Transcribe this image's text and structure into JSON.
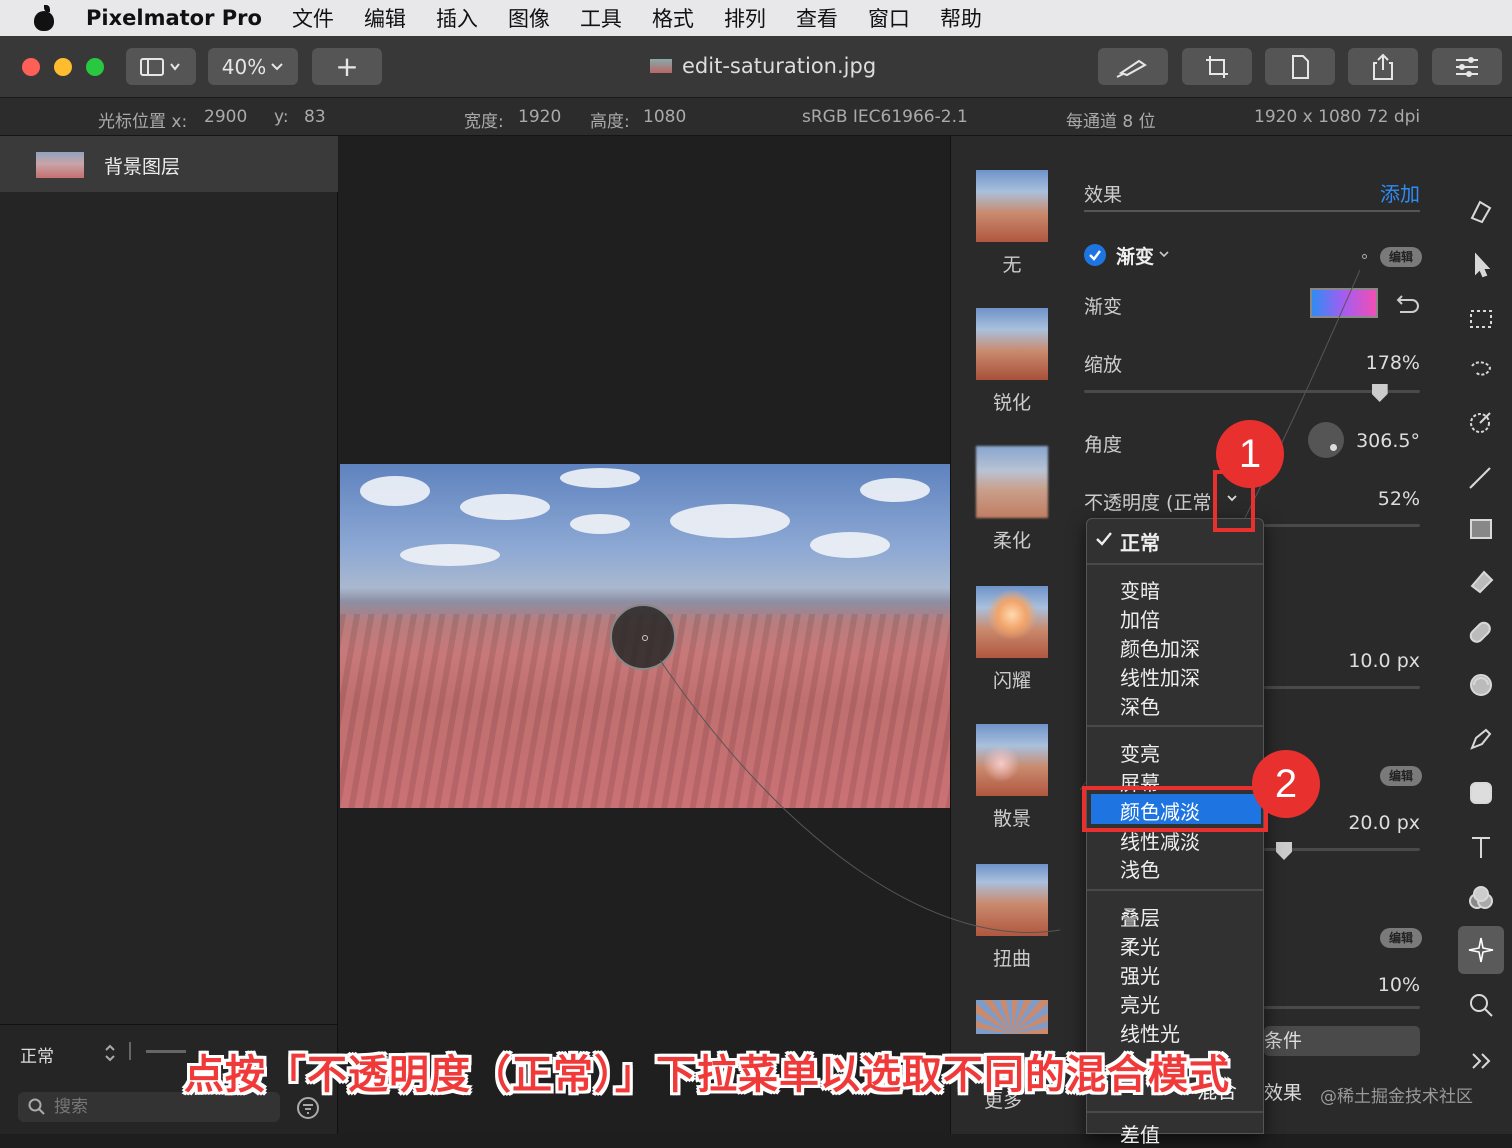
{
  "menubar": {
    "app": "Pixelmator Pro",
    "items": [
      "文件",
      "编辑",
      "插入",
      "图像",
      "工具",
      "格式",
      "排列",
      "查看",
      "窗口",
      "帮助"
    ]
  },
  "toolbar": {
    "zoom": "40%",
    "add": "+",
    "document_title": "edit-saturation.jpg"
  },
  "infobar": {
    "cursor_x_label": "光标位置 x:",
    "cursor_x": "2900",
    "cursor_y_label": "y:",
    "cursor_y": "83",
    "width_label": "宽度:",
    "width": "1920",
    "height_label": "高度:",
    "height": "1080",
    "color_profile": "sRGB IEC61966-2.1",
    "bit_depth": "每通道 8 位",
    "resolution": "1920 x 1080 72 dpi"
  },
  "layers": {
    "layer_name": "背景图层",
    "blend_mode": "正常",
    "search_placeholder": "搜索"
  },
  "presets": [
    "无",
    "锐化",
    "柔化",
    "闪耀",
    "散景",
    "扭曲"
  ],
  "effects": {
    "header": "效果",
    "add": "添加",
    "effect_name": "渐变",
    "edit_pill": "编辑",
    "gradient_label": "渐变",
    "scale_label": "缩放",
    "scale_value": "178%",
    "scale_fraction": 0.88,
    "angle_label": "角度",
    "angle_value": "306.5°",
    "opacity_label": "不透明度 (正常",
    "opacity_value": "52%",
    "px_value_1": "10.0 px",
    "px_value_2": "20.0 px",
    "pct_value_3": "10%",
    "edit_pill_2": "编辑",
    "edit_pill_3": "编辑",
    "partial_button_1": "条件",
    "partial_button_2": "效果"
  },
  "dropdown": {
    "checked": "正常",
    "group1": [
      "变暗",
      "加倍",
      "颜色加深",
      "线性加深",
      "深色"
    ],
    "group2": [
      "变亮",
      "屏幕",
      "颜色减淡",
      "线性减淡",
      "浅色"
    ],
    "group3": [
      "叠层",
      "柔光",
      "强光",
      "亮光",
      "线性光"
    ],
    "partial_bottom": "差值",
    "partial_mix": "混合"
  },
  "annotations": {
    "badge1": "1",
    "badge2": "2",
    "caption": "点按「不透明度（正常）」下拉菜单以选取不同的混合模式",
    "watermark": "@稀土掘金技术社区",
    "more_label": "更多"
  },
  "colors": {
    "accent_blue": "#1e74e0",
    "annotation_red": "#e8312f"
  }
}
